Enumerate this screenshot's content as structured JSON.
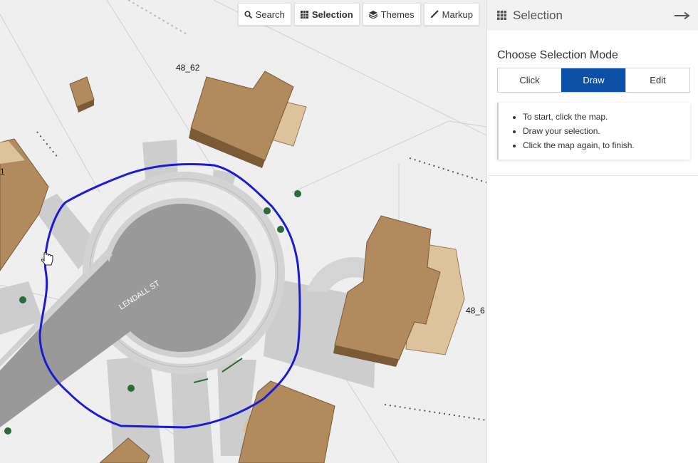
{
  "toolbar": {
    "search_label": "Search",
    "selection_label": "Selection",
    "themes_label": "Themes",
    "markup_label": "Markup"
  },
  "map": {
    "parcel_labels": [
      "48_62",
      "48_6",
      "1"
    ],
    "street_label": "LENDALL ST",
    "selection_color": "#1a1adb",
    "building_color": "#b18a5e"
  },
  "panel": {
    "title": "Selection",
    "mode_heading": "Choose Selection Mode",
    "modes": [
      "Click",
      "Draw",
      "Edit"
    ],
    "active_mode": "Draw",
    "instructions": [
      "To start, click the map.",
      "Draw your selection.",
      "Click the map again, to finish."
    ],
    "accent_color": "#0b4fa6"
  }
}
